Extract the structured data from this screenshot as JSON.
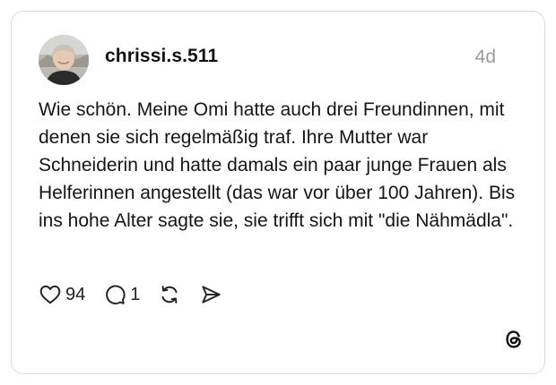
{
  "post": {
    "username": "chrissi.s.511",
    "time_ago": "4d",
    "text": "Wie schön. Meine Omi hatte auch drei Freundinnen, mit denen sie sich regelmäßig traf. Ihre Mutter war Schneiderin und hatte damals ein paar junge Frauen als Helferinnen angestellt (das war vor über 100 Jahren). Bis ins hohe Alter sagte sie, sie trifft sich mit \"die Nähmädla\"."
  },
  "actions": {
    "like_icon": "heart-icon",
    "like_count": "94",
    "reply_icon": "comment-icon",
    "reply_count": "1",
    "repost_icon": "repost-icon",
    "share_icon": "send-icon"
  },
  "branding": {
    "logo": "threads-logo-icon"
  },
  "colors": {
    "text": "#151515",
    "muted": "#9a9a9a",
    "border": "#d9d9d9"
  }
}
